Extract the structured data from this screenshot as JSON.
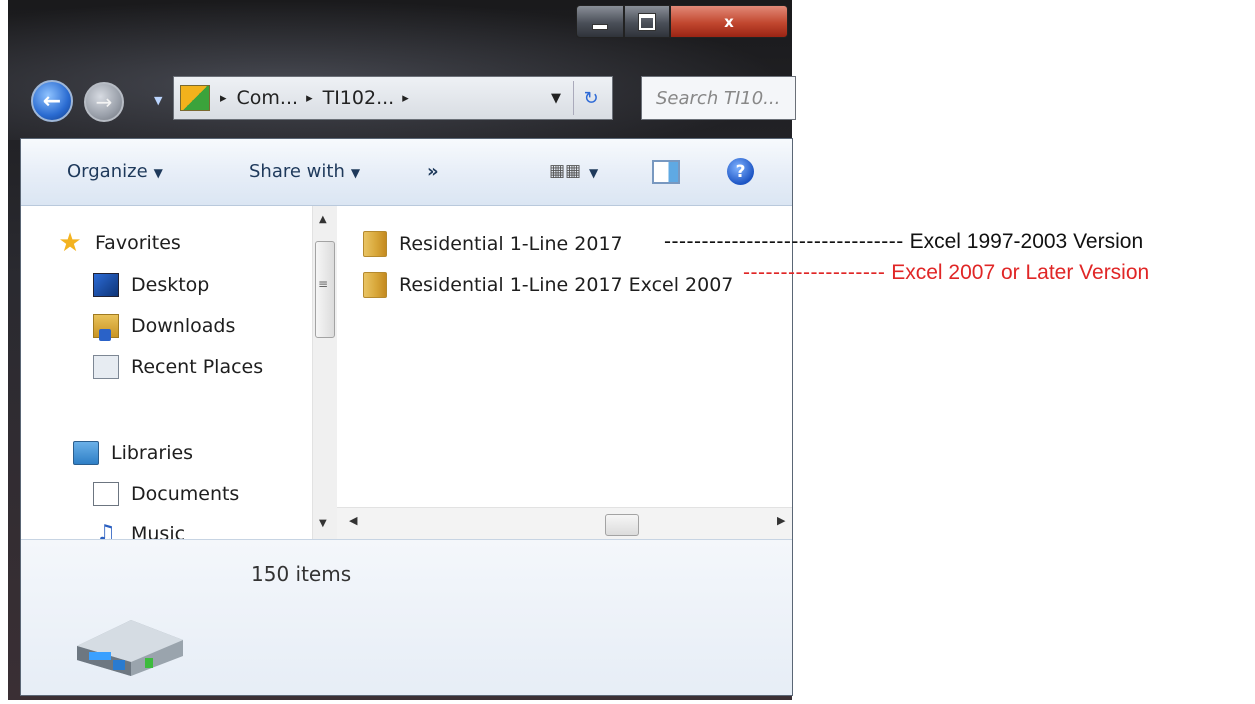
{
  "window": {
    "close_label": "x"
  },
  "address_bar": {
    "crumbs": [
      "Com...",
      "TI102..."
    ],
    "separator": "▸",
    "search_placeholder": "Search TI10..."
  },
  "toolbar": {
    "organize_label": "Organize",
    "share_label": "Share with",
    "more_label": "»",
    "help_label": "?"
  },
  "nav_pane": {
    "favorites": "Favorites",
    "desktop": "Desktop",
    "downloads": "Downloads",
    "recent_places": "Recent Places",
    "libraries": "Libraries",
    "documents": "Documents",
    "music": "Music"
  },
  "files": [
    {
      "name": "Residential 1-Line 2017"
    },
    {
      "name": "Residential 1-Line 2017 Excel 2007"
    }
  ],
  "details_pane": {
    "item_count": "150 items"
  },
  "annotations": {
    "version_1997": "Excel 1997-2003 Version",
    "version_2007": "Excel 2007 or Later Version",
    "color_black": "#111111",
    "color_red": "#e02626"
  }
}
